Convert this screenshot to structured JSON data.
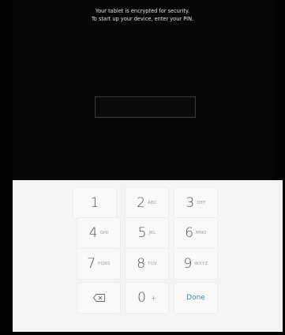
{
  "header": {
    "line1": "Your tablet is encrypted for security.",
    "line2": "To start up your device, enter your PIN."
  },
  "pin_field": {
    "value": ""
  },
  "keypad": {
    "keys": [
      {
        "num": "1",
        "sub": ""
      },
      {
        "num": "2",
        "sub": "ABC"
      },
      {
        "num": "3",
        "sub": "DEF"
      },
      {
        "num": "4",
        "sub": "GHI"
      },
      {
        "num": "5",
        "sub": "JKL"
      },
      {
        "num": "6",
        "sub": "MNO"
      },
      {
        "num": "7",
        "sub": "PQRS"
      },
      {
        "num": "8",
        "sub": "TUV"
      },
      {
        "num": "9",
        "sub": "WXYZ"
      },
      {
        "num": "0",
        "sub": "+"
      }
    ],
    "backspace_icon": "backspace-icon",
    "done_label": "Done",
    "done_color": "#4a78b8"
  }
}
